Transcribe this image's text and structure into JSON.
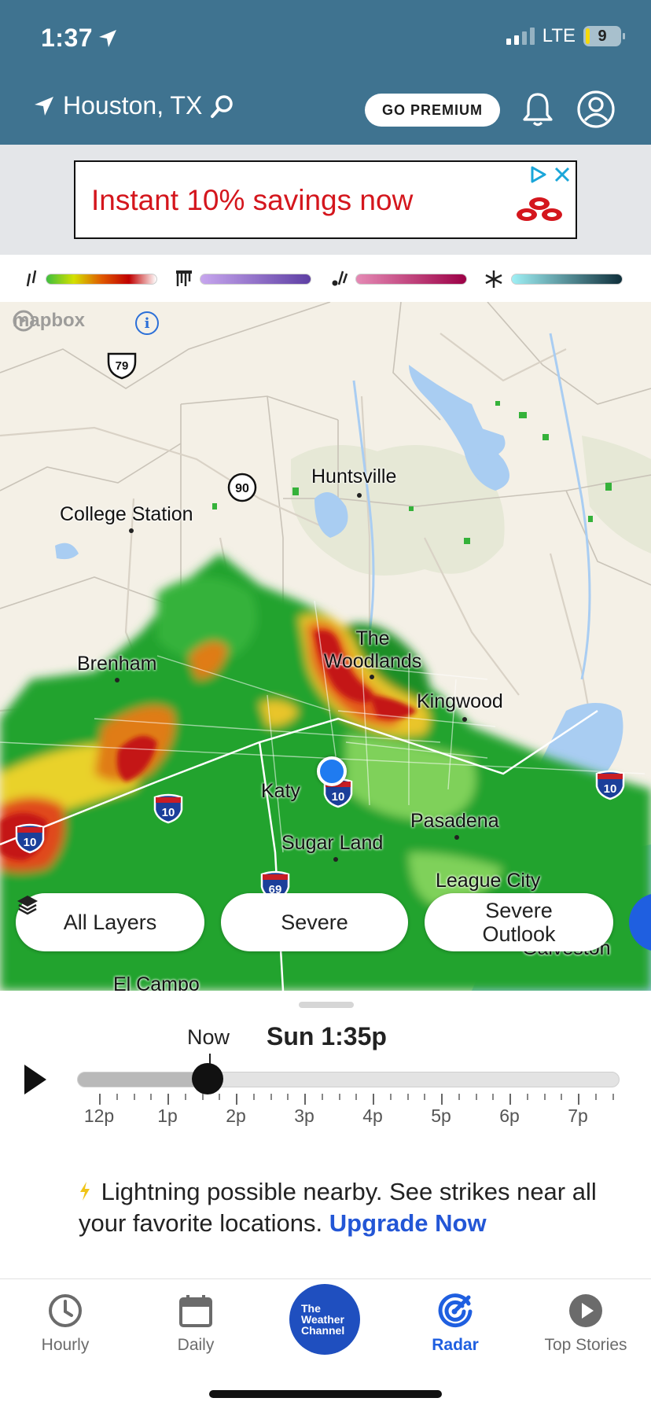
{
  "status_bar": {
    "time": "1:37",
    "network": "LTE",
    "battery": "9"
  },
  "header": {
    "location": "Houston, TX",
    "premium_label": "GO PREMIUM"
  },
  "ad": {
    "text": "Instant 10% savings now"
  },
  "legend": {
    "items": [
      {
        "icon": "rain-icon",
        "gradient": [
          "#3fbf3f",
          "#d4e000",
          "#e05a00",
          "#c00000",
          "#ffffff"
        ]
      },
      {
        "icon": "ice-icon",
        "gradient": [
          "#c7a6ee",
          "#5e3fa4"
        ]
      },
      {
        "icon": "mix-icon",
        "gradient": [
          "#e58ab5",
          "#9c0046"
        ]
      },
      {
        "icon": "snow-icon",
        "gradient": [
          "#9ff0f5",
          "#0f2f3b"
        ]
      }
    ]
  },
  "map": {
    "attribution": "mapbox",
    "info": "i",
    "cities": {
      "huntsville": "Huntsville",
      "college_station": "College Station",
      "brenham": "Brenham",
      "the_woodlands_1": "The",
      "the_woodlands_2": "Woodlands",
      "kingwood": "Kingwood",
      "katy": "Katy",
      "pasadena": "Pasadena",
      "sugar_land": "Sugar Land",
      "league_city": "League City",
      "galveston": "Galveston",
      "el_campo": "El Campo"
    },
    "shields": {
      "us79": "79",
      "us90": "90",
      "i10": "10",
      "us69": "69"
    }
  },
  "buttons": {
    "all_layers": "All Layers",
    "severe": "Severe",
    "severe_outlook_1": "Severe",
    "severe_outlook_2": "Outlook"
  },
  "timeline": {
    "now_label": "Now",
    "current_time": "Sun 1:35p",
    "hours": [
      "12p",
      "1p",
      "2p",
      "3p",
      "4p",
      "5p",
      "6p",
      "7p"
    ],
    "progress_fraction": 0.24
  },
  "alert": {
    "text": "Lightning possible nearby. See strikes near all your favorite locations.",
    "link": "Upgrade Now"
  },
  "nav": {
    "hourly": "Hourly",
    "daily": "Daily",
    "brand": "The Weather Channel",
    "radar": "Radar",
    "top_stories": "Top Stories"
  },
  "colors": {
    "header": "#3f7390",
    "accent": "#1f5fe0",
    "ad_red": "#d4161d"
  }
}
